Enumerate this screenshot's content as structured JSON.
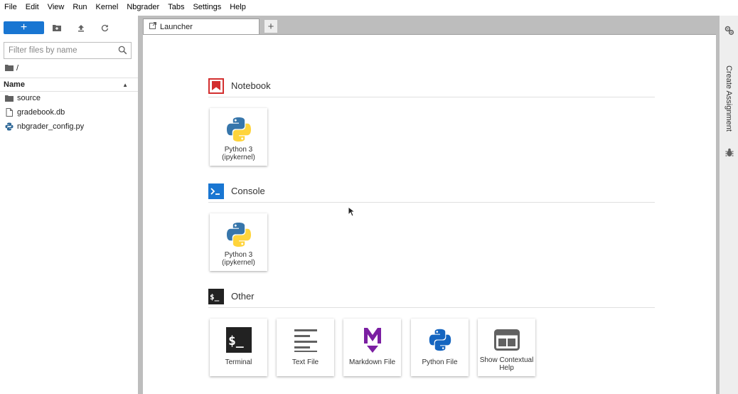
{
  "menu": [
    "File",
    "Edit",
    "View",
    "Run",
    "Kernel",
    "Nbgrader",
    "Tabs",
    "Settings",
    "Help"
  ],
  "filebrowser": {
    "new_label": "+",
    "filter_placeholder": "Filter files by name",
    "path": "/",
    "column_name": "Name",
    "files": [
      {
        "name": "source",
        "icon": "folder-icon"
      },
      {
        "name": "gradebook.db",
        "icon": "file-icon"
      },
      {
        "name": "nbgrader_config.py",
        "icon": "python-file-icon"
      }
    ]
  },
  "tabs": [
    {
      "label": "Launcher"
    }
  ],
  "add_tab_label": "+",
  "launcher": {
    "sections": [
      {
        "title": "Notebook",
        "icon": "notebook-icon",
        "cards": [
          {
            "label": "Python 3 (ipykernel)",
            "icon": "python-logo-icon"
          }
        ]
      },
      {
        "title": "Console",
        "icon": "console-icon",
        "cards": [
          {
            "label": "Python 3 (ipykernel)",
            "icon": "python-logo-icon"
          }
        ]
      },
      {
        "title": "Other",
        "icon": "terminal-icon",
        "cards": [
          {
            "label": "Terminal",
            "icon": "terminal-icon"
          },
          {
            "label": "Text File",
            "icon": "text-file-icon"
          },
          {
            "label": "Markdown File",
            "icon": "markdown-icon"
          },
          {
            "label": "Python File",
            "icon": "python-file-icon"
          },
          {
            "label": "Show Contextual Help",
            "icon": "contextual-help-icon"
          }
        ]
      }
    ]
  },
  "rightbar": {
    "label": "Create Assignment"
  },
  "colors": {
    "accent": "#1976d2",
    "notebook": "#ef6c00",
    "console": "#0277bd",
    "markdown": "#7b1fa2"
  }
}
